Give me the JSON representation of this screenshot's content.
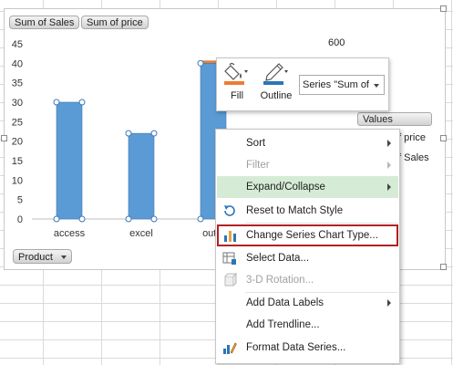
{
  "chart": {
    "field_buttons": {
      "sum_of_sales": "Sum of Sales",
      "sum_of_price": "Sum of price"
    },
    "axis_field_button": "Product",
    "legend": {
      "title": "Values",
      "item1": "f price",
      "item2": "f Sales"
    },
    "secondary_axis_label": "600",
    "colors": {
      "bar": "#5b9bd5",
      "bar_edge": "#3c78b8",
      "secondary_series": "#ed7d31"
    }
  },
  "chart_data": {
    "type": "bar",
    "categories": [
      "access",
      "excel",
      "outlo"
    ],
    "values": [
      30,
      22,
      40
    ],
    "ylim": [
      0,
      45
    ],
    "yticks": [
      0,
      5,
      10,
      15,
      20,
      25,
      30,
      35,
      40,
      45
    ],
    "secondary_axis_visible_ticks": [
      "600"
    ],
    "grid": false
  },
  "mini_toolbar": {
    "fill_label": "Fill",
    "outline_label": "Outline",
    "series_selector_value": "Series \"Sum of",
    "icons": {
      "fill": "paint-bucket-icon",
      "outline": "pen-outline-icon"
    }
  },
  "context_menu": {
    "sort": "Sort",
    "filter": "Filter",
    "expand_collapse": "Expand/Collapse",
    "reset_to_match_style": "Reset to Match Style",
    "change_series_chart_type": "Change Series Chart Type...",
    "select_data": "Select Data...",
    "rotation_3d": "3-D Rotation...",
    "add_data_labels": "Add Data Labels",
    "add_trendline": "Add Trendline...",
    "format_data_series": "Format Data Series...",
    "highlight_color": "#d5ebd5",
    "focus_box_color": "#b22222"
  }
}
